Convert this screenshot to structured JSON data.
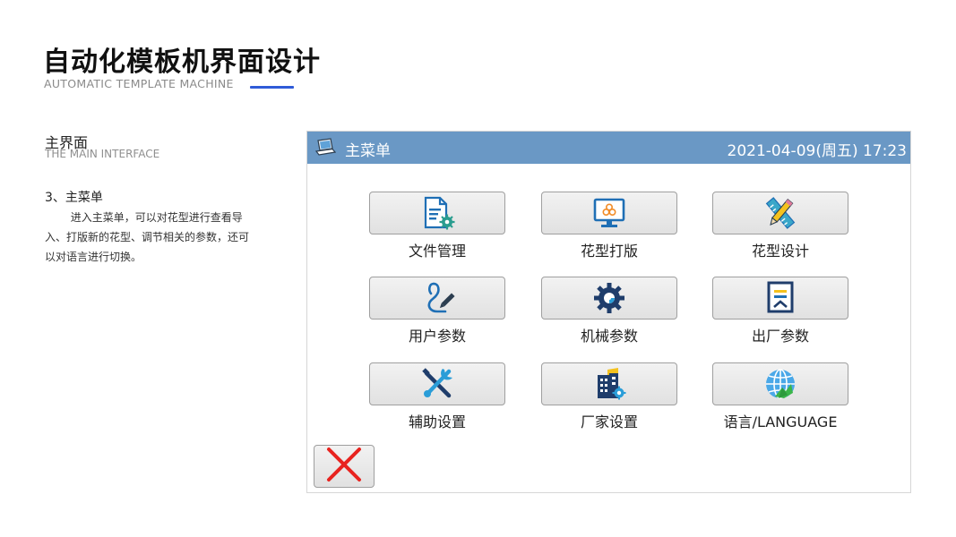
{
  "header": {
    "title": "自动化模板机界面设计",
    "subtitle": "AUTOMATIC TEMPLATE MACHINE"
  },
  "section": {
    "title": "主界面",
    "subtitle": "THE MAIN INTERFACE"
  },
  "description": {
    "title": "3、主菜单",
    "body": "进入主菜单，可以对花型进行查看导入、打版新的花型、调节相关的参数，还可以对语言进行切换。"
  },
  "screen": {
    "bar": {
      "title": "主菜单",
      "datetime": "2021-04-09(周五)  17:23",
      "icon": "laptop-icon",
      "color": "#6a98c5"
    },
    "menu": [
      {
        "label": "文件管理",
        "icon": "document-gear-icon"
      },
      {
        "label": "花型打版",
        "icon": "monitor-pattern-icon"
      },
      {
        "label": "花型设计",
        "icon": "ruler-pencil-icon"
      },
      {
        "label": "用户参数",
        "icon": "user-pen-icon"
      },
      {
        "label": "机械参数",
        "icon": "gear-icon"
      },
      {
        "label": "出厂参数",
        "icon": "clipboard-icon"
      },
      {
        "label": "辅助设置",
        "icon": "wrench-screwdriver-icon"
      },
      {
        "label": "厂家设置",
        "icon": "building-gear-icon"
      },
      {
        "label": "语言/LANGUAGE",
        "icon": "globe-icon"
      }
    ],
    "close": {
      "icon": "close-icon",
      "color": "#e8231f"
    }
  }
}
